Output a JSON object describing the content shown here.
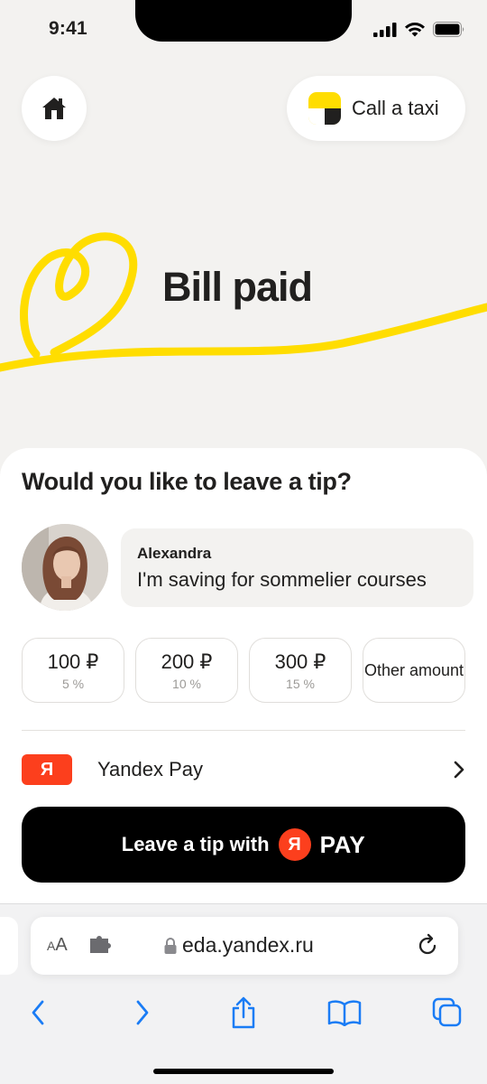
{
  "status": {
    "time": "9:41"
  },
  "header": {
    "taxi_label": "Call a taxi"
  },
  "hero": {
    "title": "Bill paid",
    "ribbon_color": "#ffdd00"
  },
  "tip": {
    "title": "Would you like to leave a tip?",
    "waiter": {
      "name": "Alexandra",
      "message": "I'm saving for sommelier courses"
    },
    "options": [
      {
        "amount": "100 ₽",
        "percent": "5 %"
      },
      {
        "amount": "200 ₽",
        "percent": "10 %"
      },
      {
        "amount": "300 ₽",
        "percent": "15 %"
      }
    ],
    "other_label": "Other amount",
    "payment": {
      "badge": "Я",
      "label": "Yandex Pay"
    },
    "cta": {
      "text": "Leave a tip with",
      "badge": "Я",
      "pay": "PAY"
    }
  },
  "browser": {
    "aa_small": "A",
    "aa_large": "A",
    "url": "eda.yandex.ru"
  },
  "colors": {
    "accent": "#fc3f1d",
    "brand_yellow": "#ffdd00",
    "background": "#f3f2f0"
  }
}
